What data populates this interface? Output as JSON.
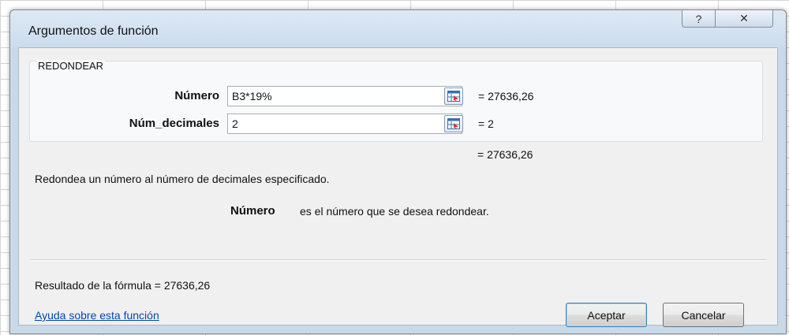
{
  "dialog": {
    "title": "Argumentos de función",
    "help_glyph": "?",
    "close_glyph": "✕"
  },
  "function_group": {
    "name": "REDONDEAR",
    "args": [
      {
        "label": "Número",
        "value": "B3*19%",
        "evaluated": "=  27636,26"
      },
      {
        "label": "Núm_decimales",
        "value": "2",
        "evaluated": "=  2"
      }
    ],
    "result_preview": "=  27636,26"
  },
  "description": "Redondea un número al número de decimales especificado.",
  "arg_help": {
    "name": "Número",
    "text": "es el número que se desea redondear."
  },
  "formula_result": "Resultado de la fórmula =  27636,26",
  "help_link": "Ayuda sobre esta función",
  "buttons": {
    "ok": "Aceptar",
    "cancel": "Cancelar"
  },
  "icons": {
    "ref": "collapse-dialog-icon"
  }
}
